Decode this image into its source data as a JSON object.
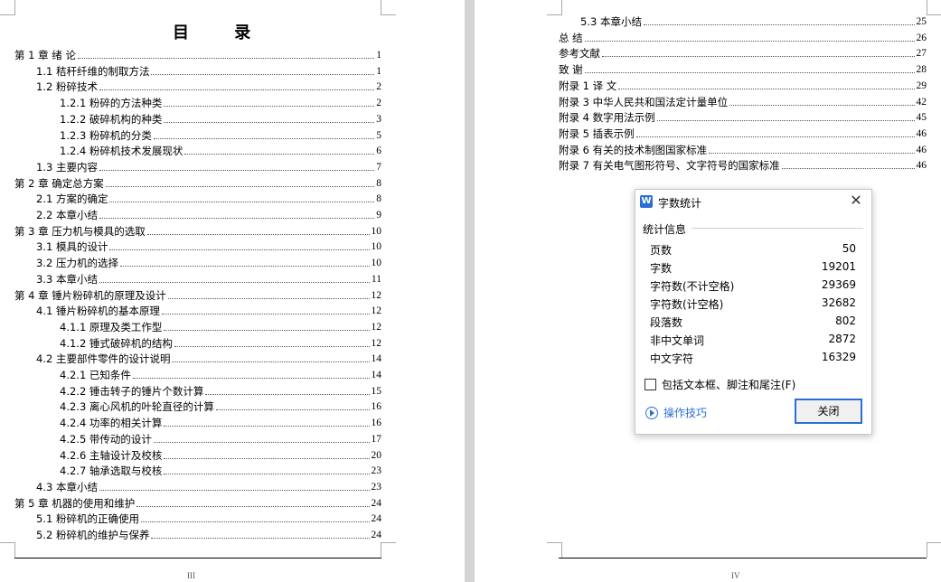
{
  "left_page": {
    "title": "目 录",
    "page_number": "III",
    "entries": [
      {
        "text": "第 1 章  绪    论",
        "page": "1"
      },
      {
        "text": "1.1  秸秆纤维的制取方法",
        "page": "1"
      },
      {
        "text": "1.2  粉碎技术",
        "page": "2"
      },
      {
        "text": "1.2.1  粉碎的方法种类",
        "page": "2"
      },
      {
        "text": "1.2.2  破碎机构的种类",
        "page": "3"
      },
      {
        "text": "1.2.3  粉碎机的分类",
        "page": "5"
      },
      {
        "text": "1.2.4  粉碎机技术发展现状",
        "page": "6"
      },
      {
        "text": "1.3  主要内容",
        "page": "7"
      },
      {
        "text": "第 2 章    确定总方案",
        "page": "8"
      },
      {
        "text": "2.1  方案的确定",
        "page": "8"
      },
      {
        "text": "2.2  本章小结",
        "page": "9"
      },
      {
        "text": "第 3 章  压力机与模具的选取",
        "page": "10"
      },
      {
        "text": "3.1  模具的设计",
        "page": "10"
      },
      {
        "text": "3.2  压力机的选择",
        "page": "10"
      },
      {
        "text": "3.3  本章小结",
        "page": "11"
      },
      {
        "text": "第 4 章  锤片粉碎机的原理及设计",
        "page": "12"
      },
      {
        "text": "4.1  锤片粉碎机的基本原理",
        "page": "12"
      },
      {
        "text": "4.1.1  原理及类工作型",
        "page": "12"
      },
      {
        "text": "4.1.2  锤式破碎机的结构",
        "page": "12"
      },
      {
        "text": "4.2 主要部件零件的设计说明",
        "page": "14"
      },
      {
        "text": "4.2.1  已知条件",
        "page": "14"
      },
      {
        "text": "4.2.2  锤击转子的锤片个数计算",
        "page": "15"
      },
      {
        "text": "4.2.3  离心风机的叶轮直径的计算",
        "page": "16"
      },
      {
        "text": "4.2.4  功率的相关计算",
        "page": "16"
      },
      {
        "text": "4.2.5  带传动的设计",
        "page": "17"
      },
      {
        "text": "4.2.6  主轴设计及校核",
        "page": "20"
      },
      {
        "text": "4.2.7  轴承选取与校核",
        "page": "23"
      },
      {
        "text": "4.3  本章小结",
        "page": "23"
      },
      {
        "text": "第 5 章  机器的使用和维护",
        "page": "24"
      },
      {
        "text": "5.1  粉碎机的正确使用",
        "page": "24"
      },
      {
        "text": "5.2  粉碎机的维护与保养",
        "page": "24"
      }
    ]
  },
  "right_page": {
    "page_number": "IV",
    "entries": [
      {
        "text": "5.3  本章小结",
        "page": "25"
      },
      {
        "text": "总    结",
        "page": "26"
      },
      {
        "text": "参考文献",
        "page": "27"
      },
      {
        "text": "致    谢",
        "page": "28"
      },
      {
        "text": "附录 1    译    文",
        "page": "29"
      },
      {
        "text": "附录 3    中华人民共和国法定计量单位",
        "page": "42"
      },
      {
        "text": "附录 4    数字用法示例",
        "page": "45"
      },
      {
        "text": "附录 5    插表示例",
        "page": "46"
      },
      {
        "text": "附录 6    有关的技术制图国家标准",
        "page": "46"
      },
      {
        "text": "附录 7    有关电气图形符号、文字符号的国家标准",
        "page": "46"
      }
    ]
  },
  "dialog": {
    "logo": "W",
    "title": "字数统计",
    "close_glyph": "✕",
    "section": "统计信息",
    "stats": [
      {
        "label": "页数",
        "value": "50"
      },
      {
        "label": "字数",
        "value": "19201"
      },
      {
        "label": "字符数(不计空格)",
        "value": "29369"
      },
      {
        "label": "字符数(计空格)",
        "value": "32682"
      },
      {
        "label": "段落数",
        "value": "802"
      },
      {
        "label": "非中文单词",
        "value": "2872"
      },
      {
        "label": "中文字符",
        "value": "16329"
      }
    ],
    "checkbox_label": "包括文本框、脚注和尾注(F)",
    "checkbox_checked": false,
    "tips_label": "操作技巧",
    "close_button": "关闭",
    "accent_color": "#2b6fd6"
  }
}
